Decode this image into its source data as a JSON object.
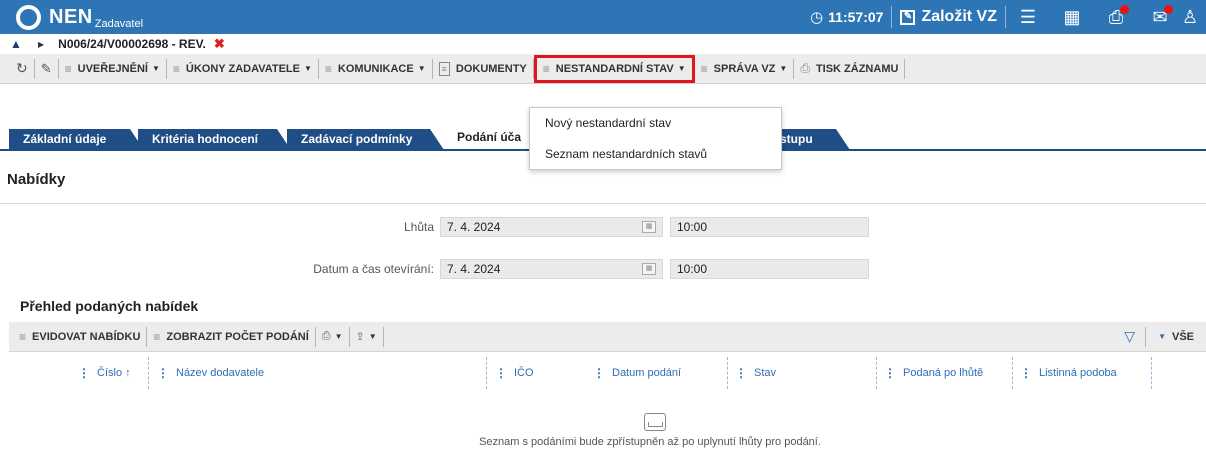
{
  "header": {
    "brand": "NEN",
    "brand_sub": "Zadavatel",
    "time": "11:57:07",
    "create_vz": "Založit VZ"
  },
  "breadcrumb": {
    "code": "N006/24/V00002698 - REV."
  },
  "toolbar": {
    "uverejneni": "UVEŘEJNĚNÍ",
    "ukony": "ÚKONY ZADAVATELE",
    "komunikace": "KOMUNIKACE",
    "dokumenty": "DOKUMENTY",
    "nestandardni": "NESTANDARDNÍ STAV",
    "sprava": "SPRÁVA VZ",
    "tisk": "TISK ZÁZNAMU"
  },
  "tabs": [
    "Základní údaje",
    "Kritéria hodnocení",
    "Zadávací podmínky",
    "Podání úča",
    "stupu"
  ],
  "dropdown": {
    "items": [
      "Nový nestandardní stav",
      "Seznam nestandardních stavů"
    ]
  },
  "section": {
    "title": "Nabídky"
  },
  "form": {
    "lhuta_label": "Lhůta",
    "lhuta_date": "7. 4. 2024",
    "lhuta_time": "10:00",
    "otevirani_label": "Datum a čas otevírání:",
    "otevirani_date": "7. 4. 2024",
    "otevirani_time": "10:00"
  },
  "overview": {
    "title": "Přehled podaných nabídek",
    "evidovat": "EVIDOVAT NABÍDKU",
    "zobrazit": "ZOBRAZIT POČET PODÁNÍ",
    "vse": "VŠE",
    "columns": [
      "Číslo ↑",
      "Název dodavatele",
      "IČO",
      "Datum podání",
      "Stav",
      "Podaná po lhůtě",
      "Listinná podoba"
    ],
    "empty_message": "Seznam s podáními bude zpřístupněn až po uplynutí lhůty pro podání."
  }
}
